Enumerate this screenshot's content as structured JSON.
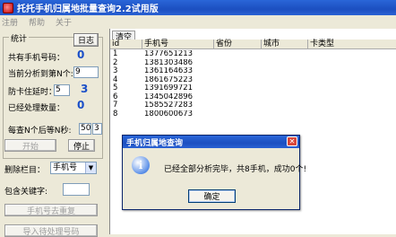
{
  "window": {
    "title": "托托手机归属地批量查询2.2试用版"
  },
  "menu": {
    "items": [
      "注册",
      "帮助",
      "关于"
    ]
  },
  "stats": {
    "group_title": "统计",
    "log_button": "日志",
    "total_label": "共有手机号码：",
    "total_value": "0",
    "current_label": "当前分析到第N个:",
    "current_value": "9",
    "delay_label": "防卡住延时：",
    "delay_value": "5",
    "delay_display": "3",
    "processed_label": "已经处理数量：",
    "processed_value": "0",
    "pause_label": "每查N个后等N秒:",
    "pause_n": "50",
    "pause_s": "3"
  },
  "controls": {
    "start_button": "开始",
    "stop_button": "停止",
    "delete_column_label": "删除栏目：",
    "delete_column_value": "手机号",
    "keyword_label": "包含关键字:",
    "keyword_value": "",
    "dedupe_button": "手机号去重复",
    "import_button": "导入待处理号码"
  },
  "list": {
    "clear_button": "清空",
    "columns": [
      "id",
      "手机号",
      "省份",
      "城市",
      "卡类型"
    ],
    "rows": [
      {
        "id": "1",
        "phone": "1377651213"
      },
      {
        "id": "2",
        "phone": "1381303486"
      },
      {
        "id": "3",
        "phone": "1361164633"
      },
      {
        "id": "4",
        "phone": "1861675223"
      },
      {
        "id": "5",
        "phone": "1391699721"
      },
      {
        "id": "6",
        "phone": "1345042896"
      },
      {
        "id": "7",
        "phone": "1585527283"
      },
      {
        "id": "8",
        "phone": "1800600673"
      }
    ]
  },
  "dialog": {
    "title": "手机归属地查询",
    "message": "已经全部分析完毕，共8手机，成功0个!",
    "ok_button": "确定"
  }
}
